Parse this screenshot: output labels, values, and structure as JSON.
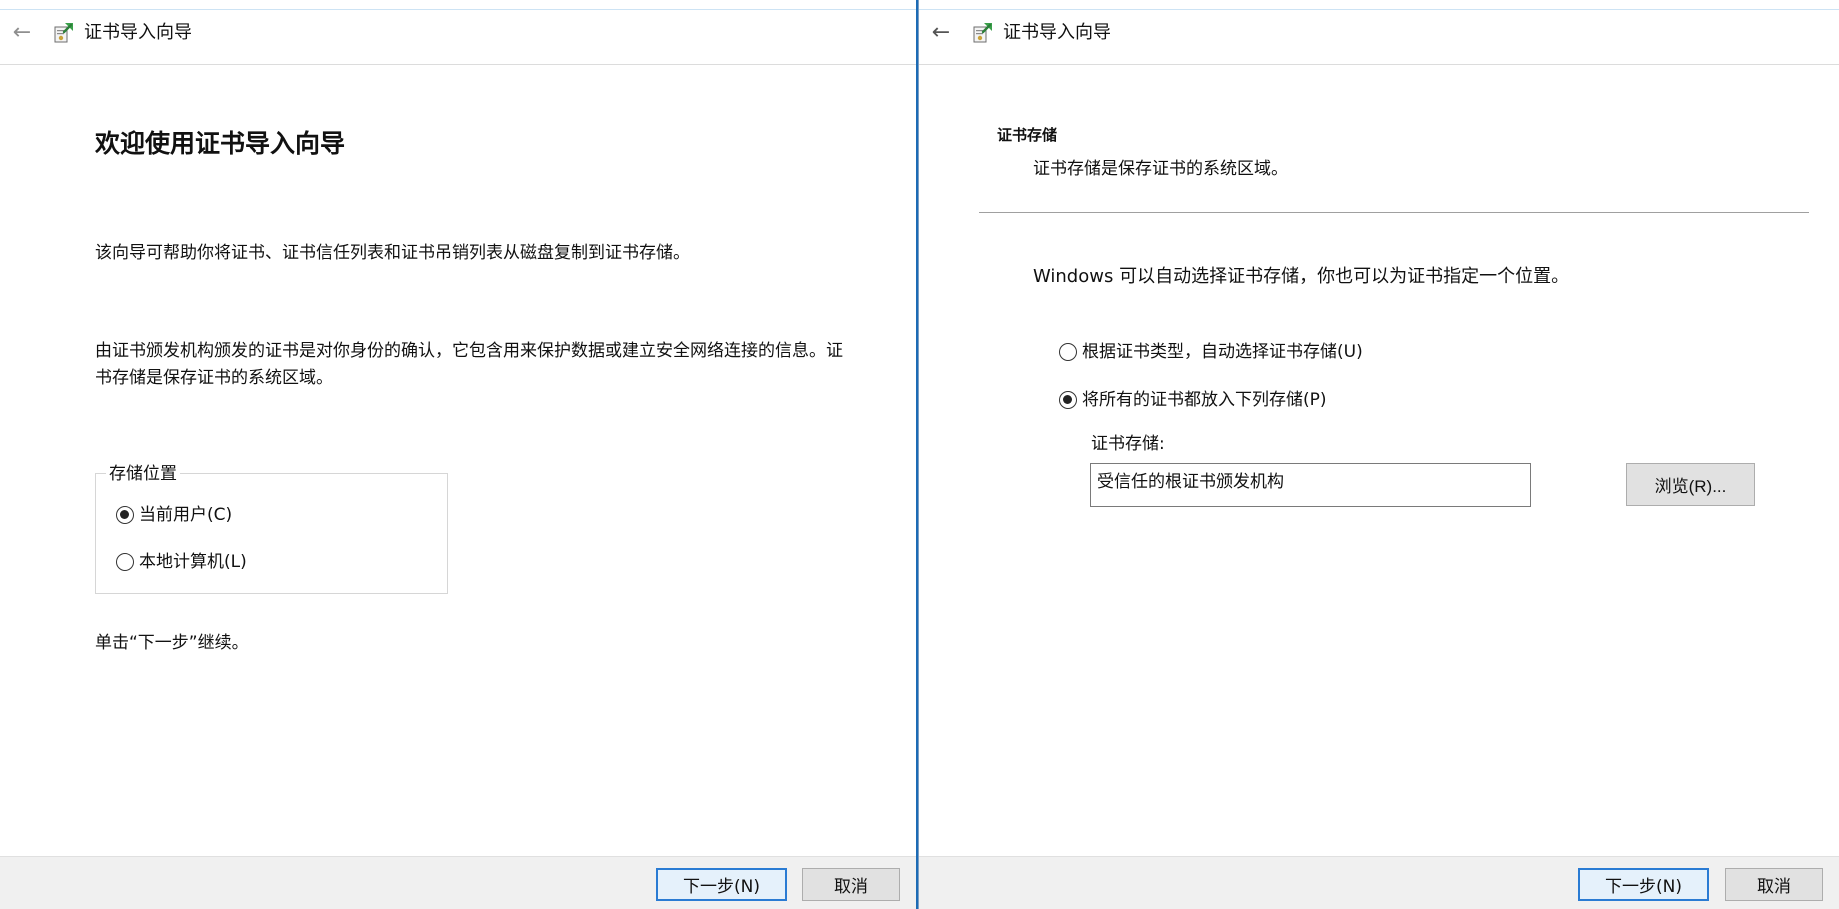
{
  "left_window": {
    "title": "证书导入向导",
    "heading": "欢迎使用证书导入向导",
    "paragraph_1": "该向导可帮助你将证书、证书信任列表和证书吊销列表从磁盘复制到证书存储。",
    "paragraph_2": "由证书颁发机构颁发的证书是对你身份的确认，它包含用来保护数据或建立安全网络连接的信息。证书存储是保存证书的系统区域。",
    "store_location": {
      "legend": "存储位置",
      "options": [
        {
          "label": "当前用户(C)",
          "checked": true
        },
        {
          "label": "本地计算机(L)",
          "checked": false
        }
      ]
    },
    "instruction": "单击“下一步”继续。",
    "buttons": {
      "next_label": "下一步(N)",
      "cancel_label": "取消"
    }
  },
  "right_window": {
    "title": "证书导入向导",
    "heading": "证书存储",
    "subheading": "证书存储是保存证书的系统区域。",
    "description": "Windows 可以自动选择证书存储，你也可以为证书指定一个位置。",
    "options": [
      {
        "label": "根据证书类型，自动选择证书存储(U)",
        "checked": false
      },
      {
        "label": "将所有的证书都放入下列存储(P)",
        "checked": true
      }
    ],
    "store_label": "证书存储:",
    "store_value": "受信任的根证书颁发机构",
    "browse_label": "浏览(R)...",
    "buttons": {
      "next_label": "下一步(N)",
      "cancel_label": "取消"
    }
  },
  "colors": {
    "accent_border": "#2a7bd3",
    "divider": "#1c6bb5",
    "footer_bg": "#f0f0f0",
    "button_bg": "#e1e1e1"
  },
  "icons": {
    "back": "back-arrow-icon",
    "wizard": "certificate-wizard-icon"
  }
}
